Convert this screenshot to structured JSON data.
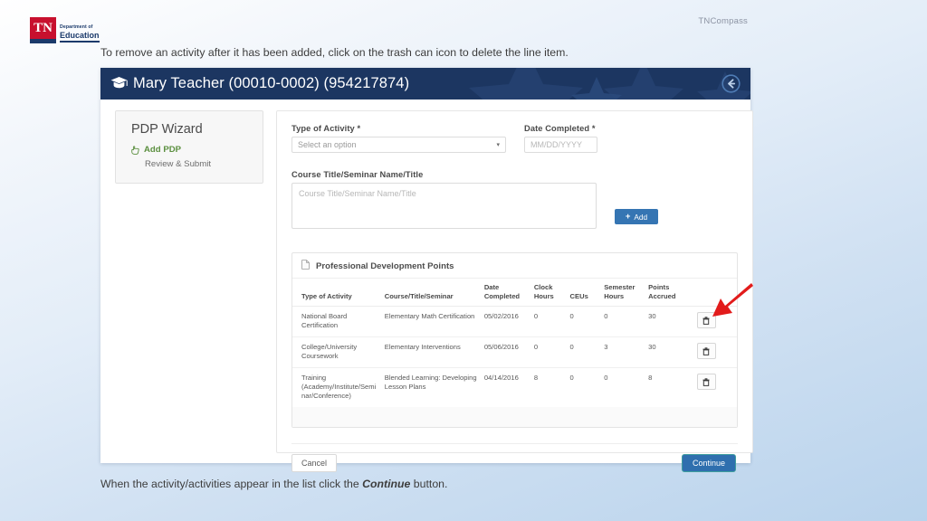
{
  "slide": {
    "logo": {
      "mark": "TN",
      "department_line": "Department of",
      "education_line": "Education"
    },
    "product_name": "TNCompass",
    "caption_top": "To remove an activity after it has been added, click on the trash can icon to delete the line item.",
    "caption_bottom_before": "When the activity/activities appear in the list click the ",
    "caption_bottom_emphasis": "Continue",
    "caption_bottom_after": " button."
  },
  "app": {
    "banner": {
      "title": "Mary Teacher (00010-0002) (954217874)",
      "cap_icon": "graduation-cap-icon",
      "back_icon": "back-arrow-circle-icon",
      "background_color": "#1c3661"
    },
    "sidebar": {
      "title": "PDP Wizard",
      "items": [
        {
          "label": "Add PDP",
          "icon": "hand-pointer-icon",
          "active": true
        },
        {
          "label": "Review & Submit",
          "icon": "",
          "active": false
        }
      ]
    },
    "form": {
      "type_of_activity": {
        "label": "Type of Activity",
        "required_mark": "*",
        "value": "Select an option",
        "caret": "▾"
      },
      "date_completed": {
        "label": "Date Completed",
        "required_mark": "*",
        "placeholder": "MM/DD/YYYY",
        "value": ""
      },
      "course_title": {
        "label": "Course Title/Seminar Name/Title",
        "placeholder": "Course Title/Seminar Name/Title",
        "value": ""
      },
      "add_button": {
        "label": "Add",
        "icon": "plus-icon",
        "color": "#3575b3"
      }
    },
    "pdp_table": {
      "section_title": "Professional Development Points",
      "section_icon": "document-icon",
      "columns": [
        "Type of Activity",
        "Course/Title/Seminar",
        "Date Completed",
        "Clock Hours",
        "CEUs",
        "Semester Hours",
        "Points Accrued"
      ],
      "rows": [
        {
          "type_of_activity": "National Board Certification",
          "course": "Elementary Math Certification",
          "date_completed": "05/02/2016",
          "clock_hours": "0",
          "ceus": "0",
          "semester_hours": "0",
          "points_accrued": "30",
          "delete_icon": "trash-icon"
        },
        {
          "type_of_activity": "College/University Coursework",
          "course": "Elementary Interventions",
          "date_completed": "05/06/2016",
          "clock_hours": "0",
          "ceus": "0",
          "semester_hours": "3",
          "points_accrued": "30",
          "delete_icon": "trash-icon"
        },
        {
          "type_of_activity": "Training (Academy/Institute/Seminar/Conference)",
          "course": "Blended Learning: Developing Lesson Plans",
          "date_completed": "04/14/2016",
          "clock_hours": "8",
          "ceus": "0",
          "semester_hours": "0",
          "points_accrued": "8",
          "delete_icon": "trash-icon"
        }
      ]
    },
    "footer": {
      "cancel_label": "Cancel",
      "continue_label": "Continue",
      "continue_color": "#2f6fae",
      "continue_highlight_color": "#3f9e9e"
    }
  },
  "annotation": {
    "arrow_color": "#e21b1b",
    "points_to": "trash-icon-row-1"
  }
}
